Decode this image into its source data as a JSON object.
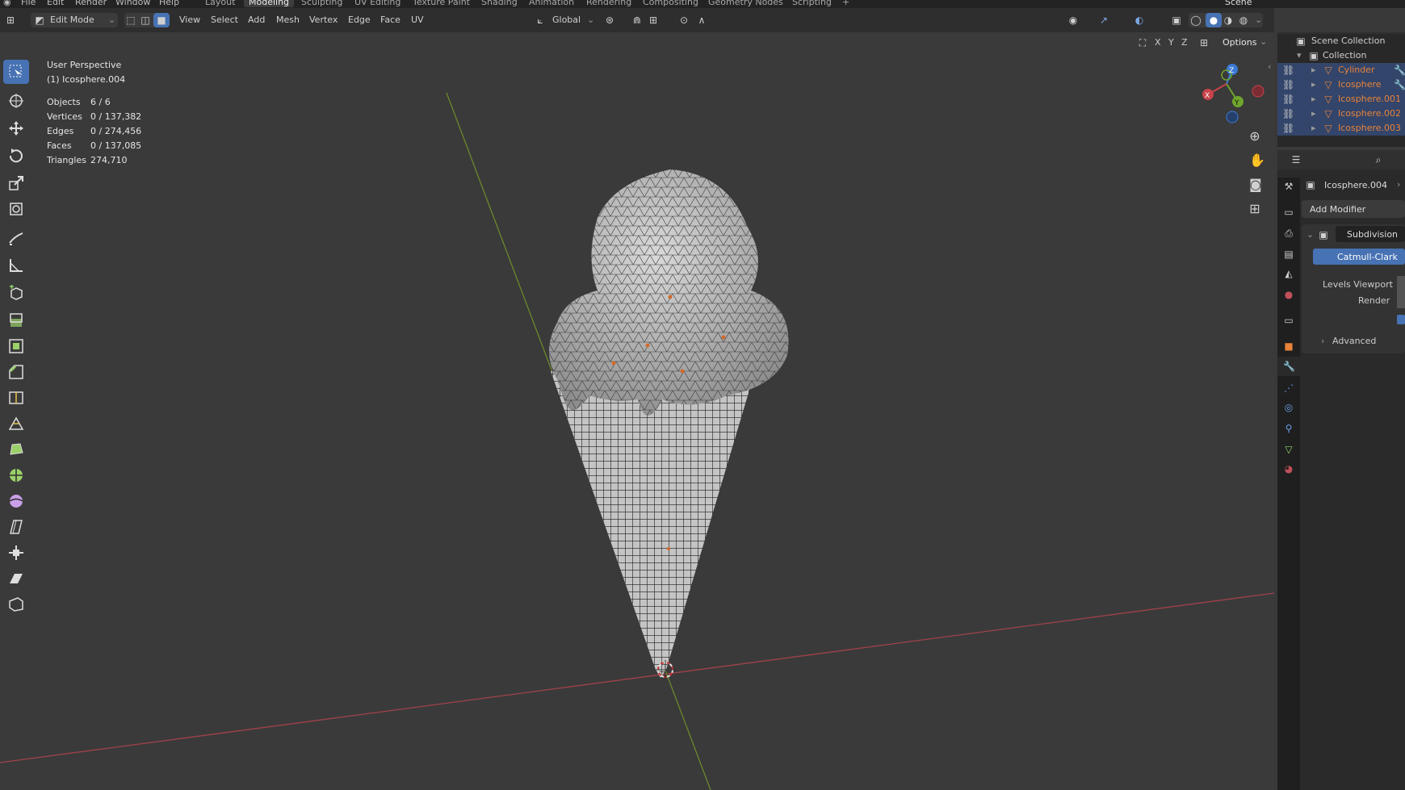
{
  "menu": {
    "items": [
      "File",
      "Edit",
      "Render",
      "Window",
      "Help"
    ],
    "workspaces": [
      "Layout",
      "Modeling",
      "Sculpting",
      "UV Editing",
      "Texture Paint",
      "Shading",
      "Animation",
      "Rendering",
      "Compositing",
      "Geometry Nodes",
      "Scripting"
    ],
    "active_workspace": "Modeling",
    "add_tab": "+",
    "scene_label": "Scene"
  },
  "header": {
    "mode": "Edit Mode",
    "menus": [
      "View",
      "Select",
      "Add",
      "Mesh",
      "Vertex",
      "Edge",
      "Face",
      "UV"
    ],
    "transform_orientation": "Global",
    "options_label": "Options",
    "axis_x": "X",
    "axis_y": "Y",
    "axis_z": "Z"
  },
  "overlay": {
    "view_name": "User Perspective",
    "active_object": "(1) Icosphere.004",
    "stats": [
      {
        "label": "Objects",
        "value": "6 / 6"
      },
      {
        "label": "Vertices",
        "value": "0 / 137,382"
      },
      {
        "label": "Edges",
        "value": "0 / 274,456"
      },
      {
        "label": "Faces",
        "value": "0 / 137,085"
      },
      {
        "label": "Triangles",
        "value": "274,710"
      }
    ]
  },
  "gizmo": {
    "x": "X",
    "y": "Y",
    "z": "Z"
  },
  "outliner": {
    "root": "Scene Collection",
    "collection": "Collection",
    "objects": [
      "Cylinder",
      "Icosphere",
      "Icosphere.001",
      "Icosphere.002",
      "Icosphere.003"
    ]
  },
  "properties": {
    "object_name": "Icosphere.004",
    "add_modifier": "Add Modifier",
    "modifier_name": "Subdivision",
    "algorithm": "Catmull-Clark",
    "levels_viewport_label": "Levels Viewport",
    "render_label": "Render",
    "advanced_label": "Advanced"
  },
  "colors": {
    "accent": "#4772b3",
    "selected_object_text": "#e8833a",
    "x_axis": "#c9434b",
    "y_axis": "#6fa52c",
    "z_axis": "#3b7ad6"
  }
}
